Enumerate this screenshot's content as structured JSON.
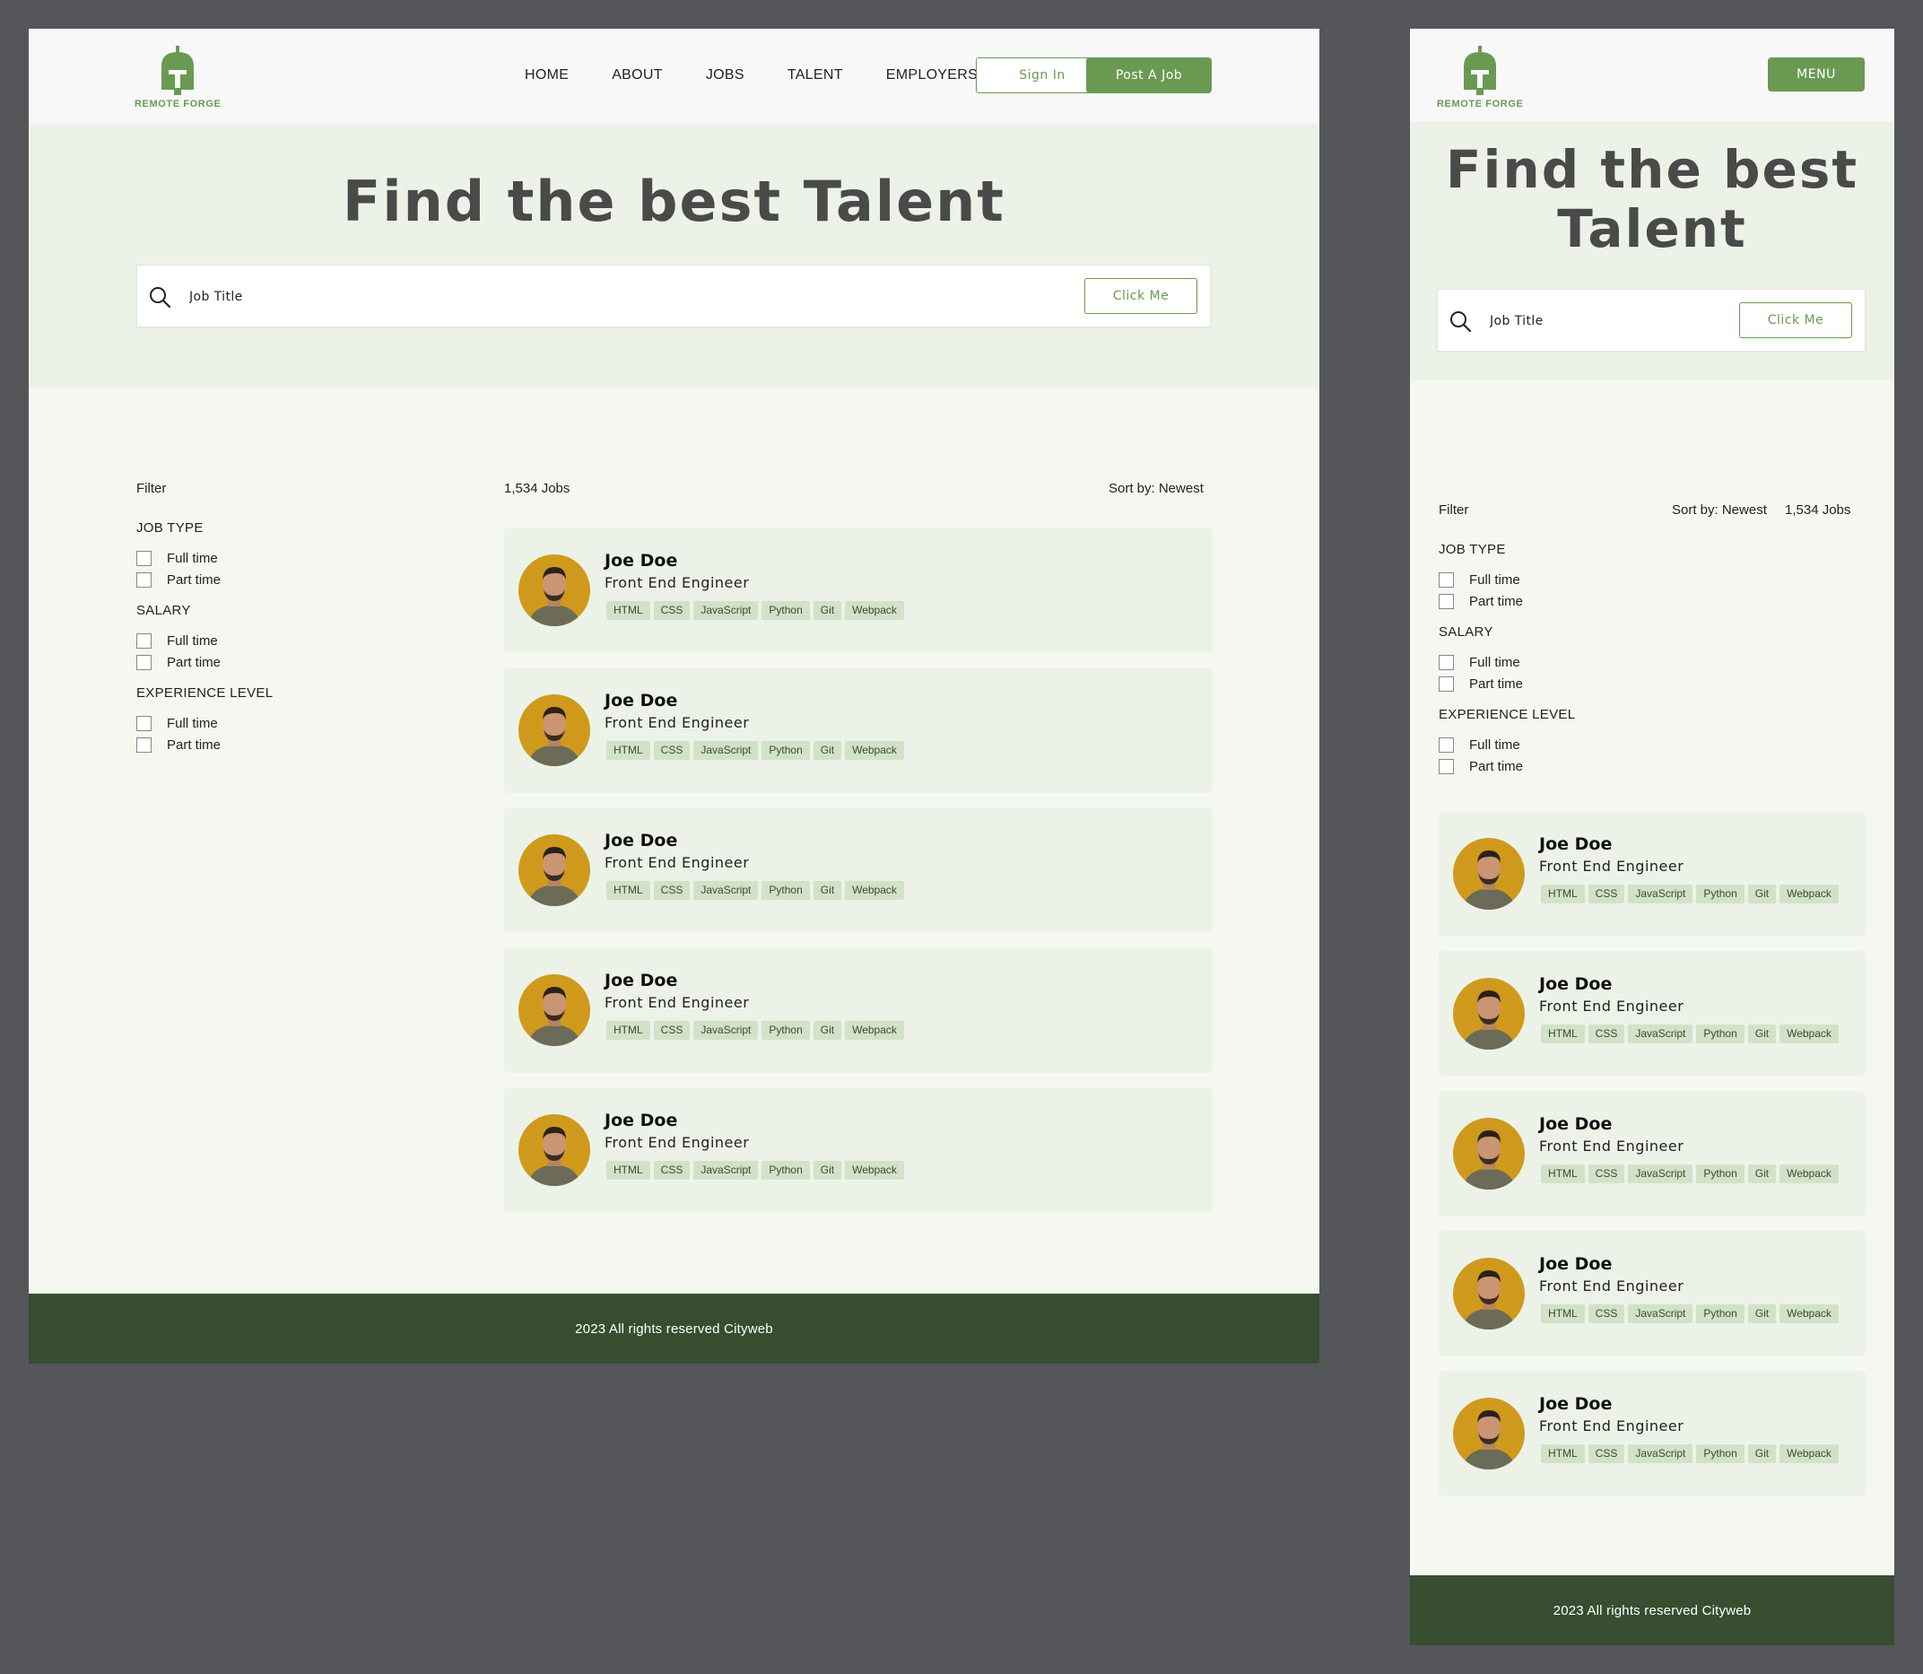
{
  "brand": {
    "name": "REMOTE FORGE",
    "color": "#6a9a52"
  },
  "colors": {
    "primary": "#6a9a52",
    "footer": "#384e30",
    "hero_bg": "#ecf2e7",
    "tag_bg": "#d2e2c8"
  },
  "nav": {
    "items": [
      {
        "label": "HOME"
      },
      {
        "label": "ABOUT"
      },
      {
        "label": "JOBS"
      },
      {
        "label": "TALENT"
      },
      {
        "label": "EMPLOYERS"
      }
    ],
    "sign_in": "Sign In",
    "post_job": "Post A Job",
    "menu": "MENU"
  },
  "hero": {
    "title": "Find the best Talent",
    "search_placeholder": "Job Title",
    "search_button": "Click Me",
    "search_icon": "search-icon"
  },
  "filters": {
    "title": "Filter",
    "groups": [
      {
        "title": "JOB TYPE",
        "options": [
          "Full time",
          "Part time"
        ]
      },
      {
        "title": "SALARY",
        "options": [
          "Full time",
          "Part time"
        ]
      },
      {
        "title": "EXPERIENCE LEVEL",
        "options": [
          "Full time",
          "Part time"
        ]
      }
    ]
  },
  "results": {
    "count": "1,534 Jobs",
    "sort": "Sort by: Newest"
  },
  "talent": [
    {
      "name": "Joe Doe",
      "role": "Front End Engineer",
      "tags": [
        "HTML",
        "CSS",
        "JavaScript",
        "Python",
        "Git",
        "Webpack"
      ]
    },
    {
      "name": "Joe Doe",
      "role": "Front End Engineer",
      "tags": [
        "HTML",
        "CSS",
        "JavaScript",
        "Python",
        "Git",
        "Webpack"
      ]
    },
    {
      "name": "Joe Doe",
      "role": "Front End Engineer",
      "tags": [
        "HTML",
        "CSS",
        "JavaScript",
        "Python",
        "Git",
        "Webpack"
      ]
    },
    {
      "name": "Joe Doe",
      "role": "Front End Engineer",
      "tags": [
        "HTML",
        "CSS",
        "JavaScript",
        "Python",
        "Git",
        "Webpack"
      ]
    },
    {
      "name": "Joe Doe",
      "role": "Front End Engineer",
      "tags": [
        "HTML",
        "CSS",
        "JavaScript",
        "Python",
        "Git",
        "Webpack"
      ]
    }
  ],
  "footer": {
    "text": "2023 All rights reserved Cityweb"
  }
}
